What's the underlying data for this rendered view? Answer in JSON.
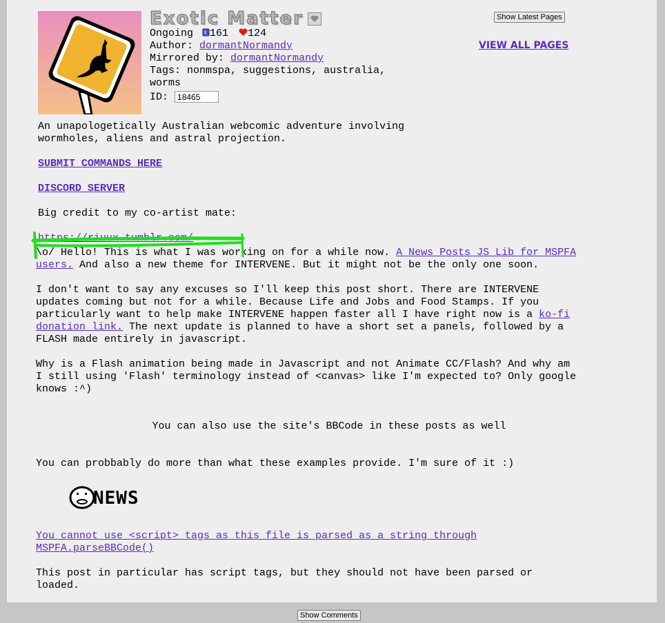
{
  "story": {
    "title": "Exotic Matter",
    "status": "Ongoing",
    "pages_count": "161",
    "favorites_count": "124",
    "author_label": "Author:",
    "author": "dormantNormandy",
    "mirrored_label": "Mirrored by:",
    "mirrored_by": "dormantNormandy",
    "tags_label": "Tags:",
    "tags_line1": "nonmspa, suggestions, australia,",
    "tags_line2": "worms",
    "id_label": "ID:",
    "id_value": "18465"
  },
  "actions": {
    "show_latest": "Show Latest Pages",
    "view_all": "VIEW ALL PAGES",
    "show_comments": "Show Comments"
  },
  "description": {
    "line1": "An unapologetically Australian webcomic adventure involving",
    "line2": "wormholes, aliens and astral projection.",
    "submit_link": "SUBMIT COMMANDS HERE",
    "discord_link": "DISCORD SERVER",
    "credit_text": "Big credit to my co-artist mate:",
    "credit_link": "https://rivux.tumblr.com/"
  },
  "news": {
    "p1_a": "\\o/ Hello! This is what I was working on for a while now.",
    "p1_link_a": "A News Posts JS Lib for MSPFA",
    "p1_link_b": "users.",
    "p1_b": "And also a new theme for INTERVENE. But it might not be the only one soon.",
    "p2_l1": "I don't want to say any excuses so I'll keep this post short. There are INTERVENE",
    "p2_l2": "updates coming but not for a while. Because Life and Jobs and Food Stamps. If you",
    "p2_l3a": "particularly want to help make INTERVENE happen faster all I have right now is a",
    "p2_link_a": "ko-fi",
    "p2_link_b": "donation link.",
    "p2_l4": "The next update is planned to have a short set a panels, followed by a",
    "p2_l5": "FLASH made entirely in javascript.",
    "p3_l1": "Why is a Flash animation being made in Javascript and not Animate CC/Flash? And why am",
    "p3_l2": "I still using 'Flash' terminology instead of <canvas> like I'm expected to? Only google",
    "p3_l3": "knows :^)",
    "centered": "You can also use the site's BBCode in these posts as well",
    "p4": "You can probbably do more than what these examples provide. I'm sure of it :)",
    "news_logo": "NEWS",
    "link_l1": "You cannot use <script> tags as this file is parsed as a string through",
    "link_l2": "MSPFA.parseBBCode()",
    "p5_l1": "This post in particular has script tags, but they should not have been parsed or",
    "p5_l2": "loaded."
  },
  "colors": {
    "link": "#5a2bc0",
    "page_bg": "#eeeeee",
    "outer_bg": "#c6c6c6",
    "annotation": "#22dd22"
  }
}
